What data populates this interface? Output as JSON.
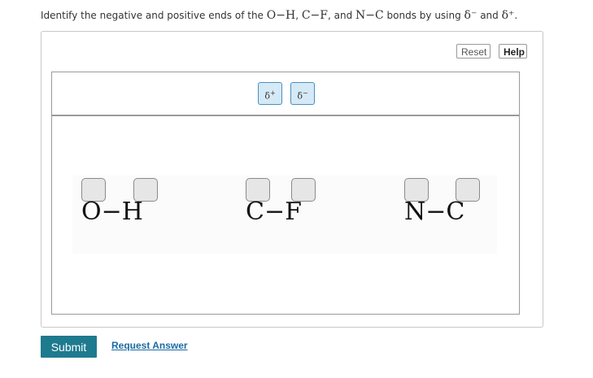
{
  "question": {
    "text_1": "Identify the negative and positive ends of the ",
    "bond_1": "O−H",
    "sep_1": ", ",
    "bond_2": "C−F",
    "sep_2": ", and ",
    "bond_3": "N−C",
    "text_2": " bonds by using ",
    "delta_minus": "δ⁻",
    "text_3": " and ",
    "delta_plus": "δ⁺",
    "text_4": "."
  },
  "toolbar": {
    "reset_label": "Reset",
    "help_label": "Help"
  },
  "tray": {
    "labels": [
      {
        "symbol": "δ",
        "sign": "+"
      },
      {
        "symbol": "δ",
        "sign": "−"
      }
    ]
  },
  "bonds": [
    {
      "formula": "O−H"
    },
    {
      "formula": "C−F"
    },
    {
      "formula": "N−C"
    }
  ],
  "actions": {
    "submit_label": "Submit",
    "request_label": "Request Answer"
  }
}
